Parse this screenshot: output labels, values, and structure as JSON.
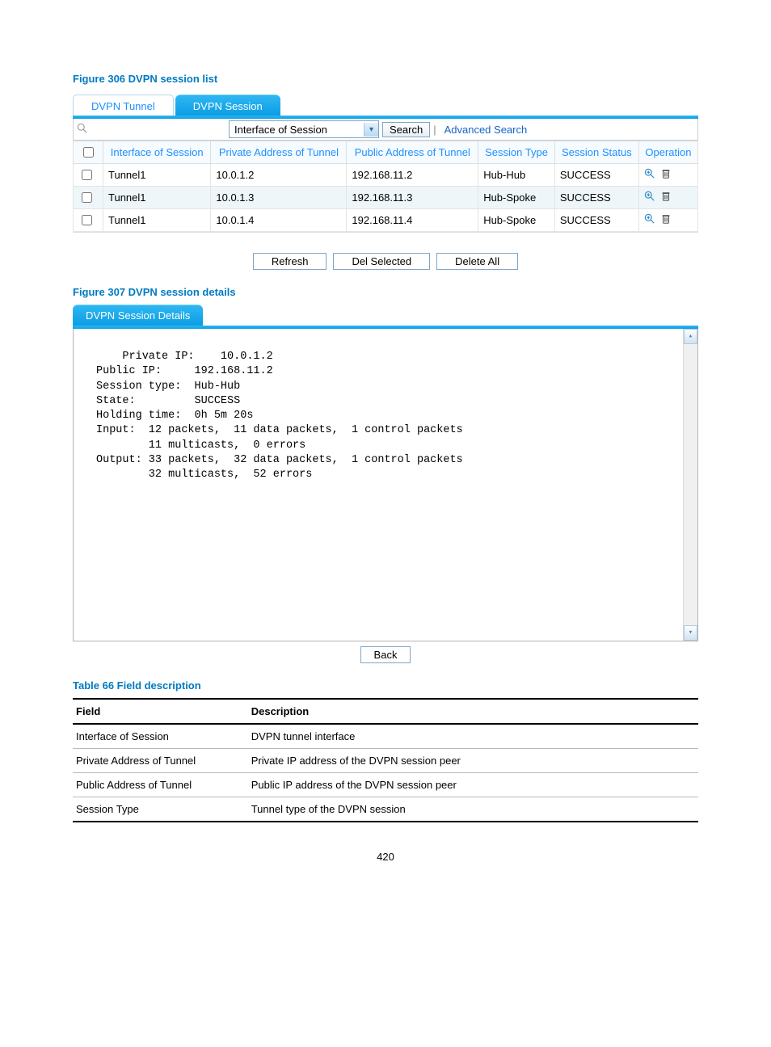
{
  "fig306": {
    "caption": "Figure 306 DVPN session list",
    "tabs": {
      "tunnel": "DVPN Tunnel",
      "session": "DVPN Session"
    },
    "search": {
      "field_label": "Interface of Session",
      "button": "Search",
      "advanced": "Advanced Search"
    },
    "headers": {
      "iface": "Interface of Session",
      "priv": "Private Address of Tunnel",
      "pub": "Public Address of Tunnel",
      "type": "Session Type",
      "status": "Session Status",
      "op": "Operation"
    },
    "rows": [
      {
        "iface": "Tunnel1",
        "priv": "10.0.1.2",
        "pub": "192.168.11.2",
        "type": "Hub-Hub",
        "status": "SUCCESS"
      },
      {
        "iface": "Tunnel1",
        "priv": "10.0.1.3",
        "pub": "192.168.11.3",
        "type": "Hub-Spoke",
        "status": "SUCCESS"
      },
      {
        "iface": "Tunnel1",
        "priv": "10.0.1.4",
        "pub": "192.168.11.4",
        "type": "Hub-Spoke",
        "status": "SUCCESS"
      }
    ],
    "buttons": {
      "refresh": "Refresh",
      "del_sel": "Del Selected",
      "del_all": "Delete All"
    }
  },
  "fig307": {
    "caption": "Figure 307 DVPN session details",
    "tab": "DVPN Session Details",
    "details_text": "Private IP:    10.0.1.2\nPublic IP:     192.168.11.2\nSession type:  Hub-Hub\nState:         SUCCESS\nHolding time:  0h 5m 20s\nInput:  12 packets,  11 data packets,  1 control packets\n        11 multicasts,  0 errors\nOutput: 33 packets,  32 data packets,  1 control packets\n        32 multicasts,  52 errors",
    "back": "Back"
  },
  "tbl66": {
    "caption": "Table 66 Field description",
    "headers": {
      "field": "Field",
      "desc": "Description"
    },
    "rows": [
      {
        "field": "Interface of Session",
        "desc": "DVPN tunnel interface"
      },
      {
        "field": "Private Address of Tunnel",
        "desc": "Private IP address of the DVPN session peer"
      },
      {
        "field": "Public Address of Tunnel",
        "desc": "Public IP address of the DVPN session peer"
      },
      {
        "field": "Session Type",
        "desc": "Tunnel type of the DVPN session"
      }
    ]
  },
  "page_number": "420"
}
